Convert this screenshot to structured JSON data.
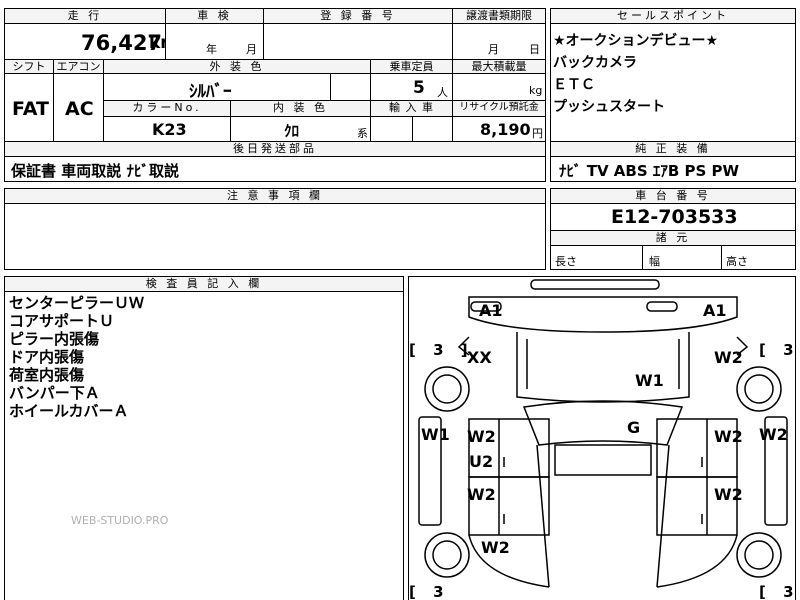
{
  "headers": {
    "mileage": "走 行",
    "inspection": "車 検",
    "registration": "登 録 番 号",
    "transfer_deadline": "譲渡書類期限",
    "sales_point": "セールスポイント",
    "shift": "シフト",
    "aircon": "エアコン",
    "exterior_color": "外 装 色",
    "capacity": "乗車定員",
    "max_load": "最大積載量",
    "color_no": "カラーNo.",
    "interior_color": "内 装 色",
    "import": "輸 入 車",
    "recycle": "リサイクル預託金",
    "later_parts": "後日発送部品",
    "standard_equipment": "純 正 装 備",
    "caution": "注 意 事 項 欄",
    "chassis_no": "車 台 番 号",
    "dimensions": "諸 元",
    "inspector_notes": "検 査 員 記 入 欄"
  },
  "vehicle": {
    "mileage": "76,427",
    "mileage_unit": "km",
    "inspection_year_unit": "年",
    "inspection_month_unit": "月",
    "transfer_month_unit": "月",
    "transfer_day_unit": "日",
    "shift": "FAT",
    "aircon": "AC",
    "exterior_color": "ｼﾙﾊﾞｰ",
    "capacity": "5",
    "capacity_unit": "人",
    "max_load_unit": "kg",
    "color_no": "K23",
    "interior_color": "ｸﾛ",
    "interior_suffix": "系",
    "recycle": "8,190",
    "recycle_unit": "円",
    "later_parts": "保証書 車両取説 ﾅﾋﾞ取説",
    "standard_equipment": "ﾅﾋﾞ TV ABS ｴｱB PS PW",
    "chassis_no": "E12-703533",
    "length_label": "長さ",
    "width_label": "幅",
    "height_label": "高さ"
  },
  "sales_points": [
    "★オークションデビュー★",
    "バックカメラ",
    "ＥＴＣ",
    "プッシュスタート"
  ],
  "inspector_notes": [
    "センターピラーＵＷ",
    "コアサポートＵ",
    "ピラー内張傷",
    "ドア内張傷",
    "荷室内張傷",
    "バンパー下Ａ",
    "ホイールカバーＡ"
  ],
  "watermark": "WEB-STUDIO.PRO",
  "diagram_marks": {
    "a1_left": "A1",
    "a1_right": "A1",
    "xx": "XX",
    "w1_roof": "W1",
    "g": "G",
    "w2_tr": "W2",
    "w1_left_side": "W1",
    "w2_right_side": "W2",
    "w2_ld1": "W2",
    "u2": "U2",
    "w2_rd1": "W2",
    "w2_ld2": "W2",
    "w2_rd2": "W2",
    "w2_lower_left": "W2",
    "bracket_tl": "[ 3 ]",
    "bracket_tr": "[ 3 ]",
    "bracket_bl": "[ 3",
    "bracket_br": "[ 3"
  }
}
